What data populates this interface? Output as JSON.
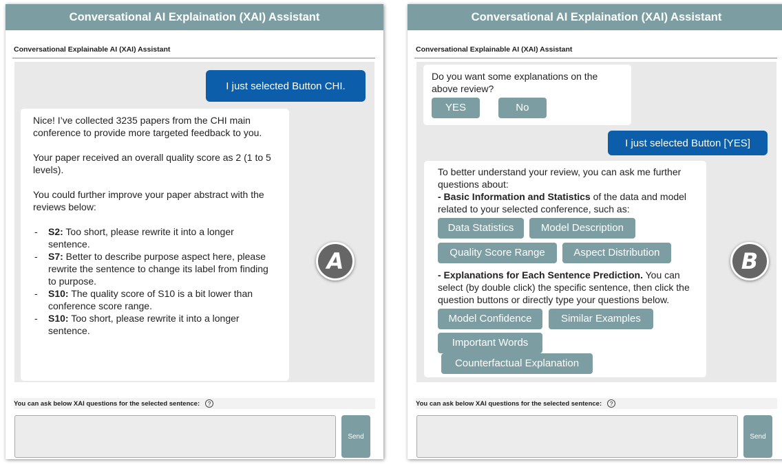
{
  "panels": {
    "a": {
      "header_title": "Conversational AI Explaination (XAI) Assistant",
      "subtitle": "Conversational Explainable AI (XAI) Assistant",
      "user_message": "I just selected Button CHI.",
      "bot": {
        "p1": "Nice! I’ve collected 3235 papers from the CHI main conference to provide more targeted feedback to you.",
        "p2": "Your paper received an overall quality score as 2 (1 to 5 levels).",
        "p3": "You could further improve your paper abstract with the reviews below:",
        "reviews": [
          {
            "label": "S2:",
            "text": " Too short, please rewrite it into a longer sentence."
          },
          {
            "label": "S7:",
            "text": " Better to describe purpose aspect here, please rewrite the sentence to change its label from finding to purpose."
          },
          {
            "label": "S10:",
            "text": " The quality score of S10 is a bit lower than conference score range."
          },
          {
            "label": "S10:",
            "text": " Too short, please rewrite it into a longer sentence."
          }
        ]
      },
      "badge_letter": "A",
      "ask_label": "You can ask below XAI questions for the selected sentence:",
      "help_glyph": "?",
      "send_label": "Send"
    },
    "b": {
      "header_title": "Conversational AI Explaination (XAI) Assistant",
      "subtitle": "Conversational Explainable AI (XAI) Assistant",
      "question": "Do you want some explanations on the above review?",
      "yes_label": "YES",
      "no_label": "No",
      "user_message": "I just selected Button [YES]",
      "bot": {
        "intro": "To better understand your review, you can ask me further questions about:",
        "section1_bold": "- Basic Information and Statistics",
        "section1_rest": " of the data and model related to your selected conference, such as:",
        "section1_buttons": [
          "Data Statistics",
          "Model Description",
          "Quality Score Range",
          "Aspect Distribution"
        ],
        "section2_bold": "- Explanations for Each Sentence Prediction.",
        "section2_rest": " You can select (by double click) the specific sentence, then click the question buttons or directly type your questions below.",
        "section2_buttons": [
          "Model Confidence",
          "Similar Examples",
          "Important Words",
          "Counterfactual Explanation"
        ]
      },
      "badge_letter": "B",
      "ask_label": "You can ask below XAI questions for the selected sentence:",
      "help_glyph": "?",
      "send_label": "Send"
    }
  },
  "colors": {
    "header_bg": "#7c9ea3",
    "user_bubble": "#0d5eaa",
    "chip_bg": "#7c9ea3",
    "chat_bg": "#e9e9e9"
  }
}
